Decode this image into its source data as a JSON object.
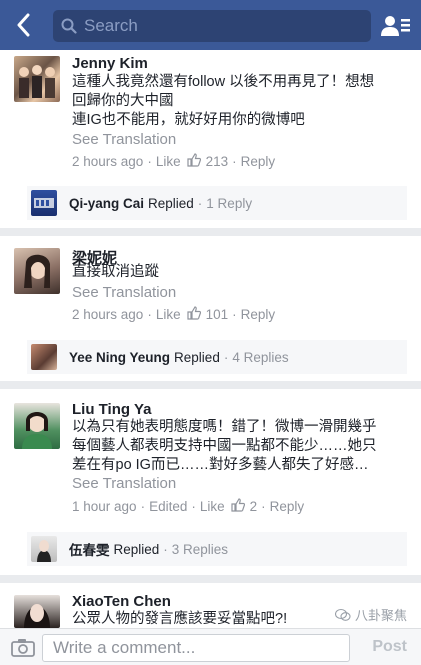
{
  "header": {
    "search_placeholder": "Search",
    "back_icon": "chevron-left-icon",
    "friends_icon": "friend-requests-icon",
    "bar_color": "#3b5998"
  },
  "comments": [
    {
      "name": "Jenny Kim",
      "lines": [
        "這種人我竟然還有follow 以後不用再見了！想想",
        "回歸你的大中國",
        "連IG也不能用，就好好用你的微博吧"
      ],
      "see_translation": "See Translation",
      "time": "2 hours ago",
      "like_label": "Like",
      "like_count": "213",
      "reply_label": "Reply",
      "replier": "Qi-yang Cai",
      "replied_label": "Replied",
      "reply_count": "1 Reply"
    },
    {
      "name": "梁妮妮",
      "lines": [
        "直接取消追蹤"
      ],
      "see_translation": "See Translation",
      "time": "2 hours ago",
      "like_label": "Like",
      "like_count": "101",
      "reply_label": "Reply",
      "replier": "Yee Ning Yeung",
      "replied_label": "Replied",
      "reply_count": "4 Replies"
    },
    {
      "name": "Liu Ting Ya",
      "lines": [
        "以為只有她表明態度嗎！錯了！微博一滑開幾乎",
        "每個藝人都表明支持中國一點都不能少……她只",
        "差在有po IG而已……對好多藝人都失了好感…"
      ],
      "see_translation": "See Translation",
      "time": "1 hour ago",
      "edited_label": "Edited",
      "like_label": "Like",
      "like_count": "2",
      "reply_label": "Reply",
      "replier": "伍春雯",
      "replied_label": "Replied",
      "reply_count": "3 Replies"
    },
    {
      "name": "XiaoTen Chen",
      "lines": [
        "公眾人物的發言應該要妥當點吧?!"
      ]
    }
  ],
  "footer": {
    "placeholder": "Write a comment...",
    "post_label": "Post",
    "watermark": "八卦聚焦"
  }
}
